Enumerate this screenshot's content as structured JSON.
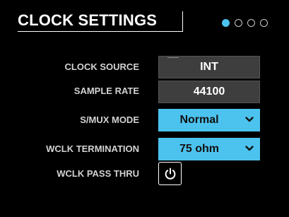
{
  "header": {
    "title": "CLOCK SETTINGS",
    "page_count": 4,
    "active_page": 1
  },
  "rows": {
    "clock_source": {
      "label": "CLOCK SOURCE",
      "value": "INT"
    },
    "sample_rate": {
      "label": "SAMPLE RATE",
      "value": "44100"
    },
    "smux_mode": {
      "label": "S/MUX MODE",
      "value": "Normal"
    },
    "wclk_termination": {
      "label": "WCLK TERMINATION",
      "value": "75 ohm"
    },
    "wclk_pass_thru": {
      "label": "WCLK PASS THRU",
      "icon": "power-icon"
    }
  },
  "colors": {
    "accent": "#4cc3ee",
    "readonly_field": "#3e3e3e",
    "background": "#000000",
    "label_text": "#d2d2d2"
  }
}
